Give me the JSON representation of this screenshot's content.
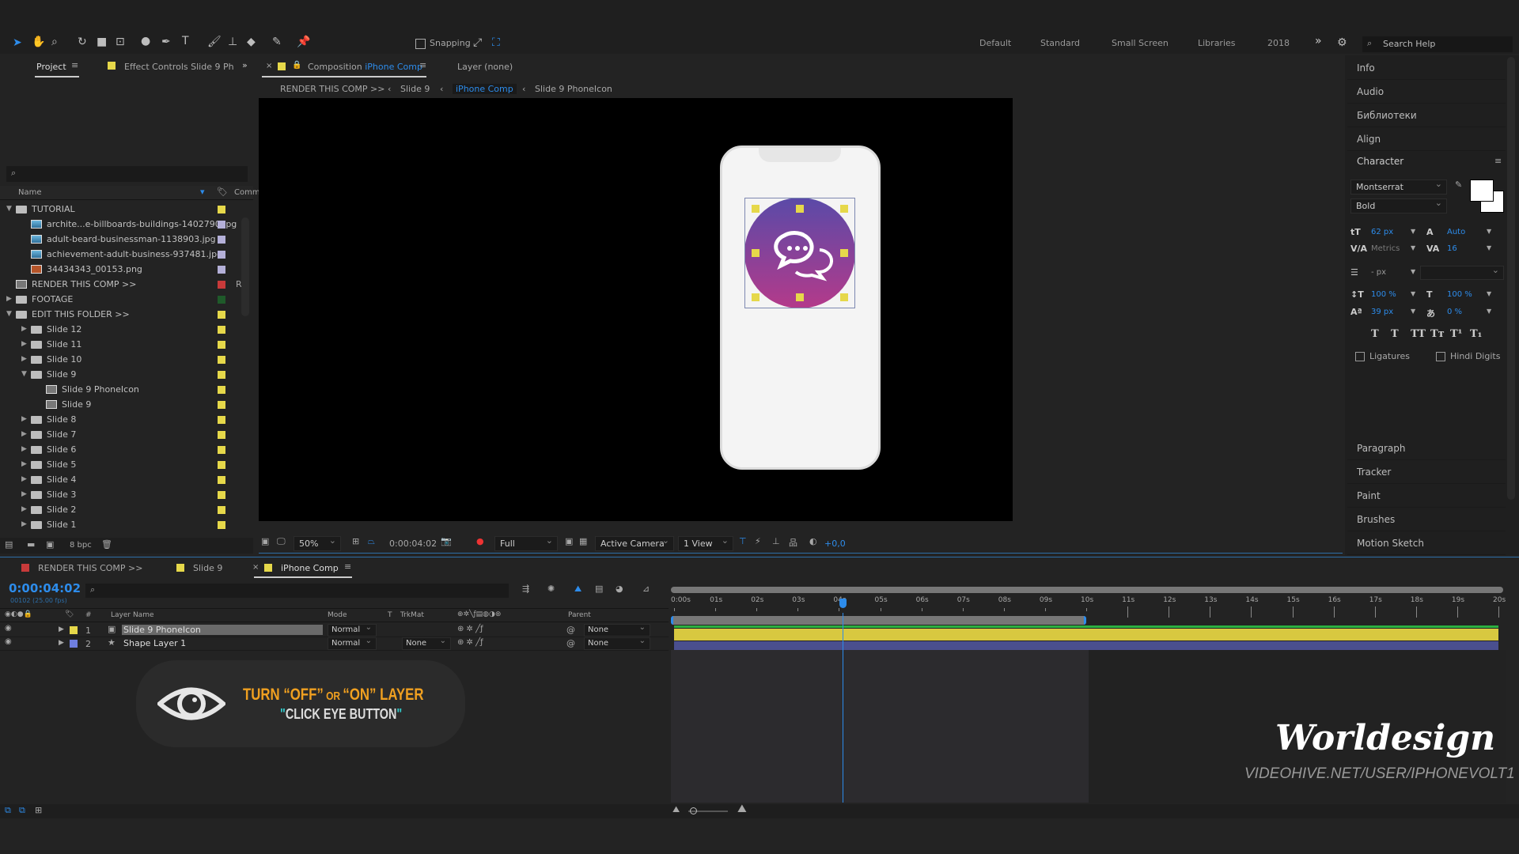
{
  "toolbar": {
    "snapping_label": "Snapping",
    "workspaces": [
      "Default",
      "Standard",
      "Small Screen",
      "Libraries",
      "2018"
    ],
    "more": "»",
    "search_placeholder": "Search Help"
  },
  "project": {
    "tab_label": "Project",
    "effect_tab_label": "Effect Controls Slide 9 Ph",
    "more": "»",
    "search_placeholder": "",
    "col_name": "Name",
    "col_comment": "Comm",
    "items": [
      {
        "label": "TUTORIAL",
        "type": "folder",
        "depth": 0,
        "expanded": true,
        "color": "#e6d84a"
      },
      {
        "label": "archite...e-billboards-buildings-1402790.jpg",
        "type": "image",
        "depth": 1,
        "color": "#b4b0d8"
      },
      {
        "label": "adult-beard-businessman-1138903.jpg",
        "type": "image",
        "depth": 1,
        "color": "#b4b0d8"
      },
      {
        "label": "achievement-adult-business-937481.jpg",
        "type": "image",
        "depth": 1,
        "color": "#b4b0d8"
      },
      {
        "label": "34434343_00153.png",
        "type": "png",
        "depth": 1,
        "color": "#b4b0d8"
      },
      {
        "label": "RENDER THIS COMP >>",
        "type": "comp",
        "depth": 0,
        "color": "#c83a3a",
        "comment": "R"
      },
      {
        "label": "FOOTAGE",
        "type": "folder",
        "depth": 0,
        "expanded": false,
        "color": "#1f5a2a"
      },
      {
        "label": "EDIT THIS FOLDER >>",
        "type": "folder",
        "depth": 0,
        "expanded": true,
        "color": "#e6d84a"
      },
      {
        "label": "Slide 12",
        "type": "folder",
        "depth": 1,
        "expanded": false,
        "color": "#e6d84a"
      },
      {
        "label": "Slide 11",
        "type": "folder",
        "depth": 1,
        "expanded": false,
        "color": "#e6d84a"
      },
      {
        "label": "Slide 10",
        "type": "folder",
        "depth": 1,
        "expanded": false,
        "color": "#e6d84a"
      },
      {
        "label": "Slide 9",
        "type": "folder",
        "depth": 1,
        "expanded": true,
        "color": "#e6d84a"
      },
      {
        "label": "Slide 9 PhoneIcon",
        "type": "comp",
        "depth": 2,
        "color": "#e6d84a"
      },
      {
        "label": "Slide 9",
        "type": "comp",
        "depth": 2,
        "color": "#e6d84a"
      },
      {
        "label": "Slide 8",
        "type": "folder",
        "depth": 1,
        "expanded": false,
        "color": "#e6d84a"
      },
      {
        "label": "Slide 7",
        "type": "folder",
        "depth": 1,
        "expanded": false,
        "color": "#e6d84a"
      },
      {
        "label": "Slide 6",
        "type": "folder",
        "depth": 1,
        "expanded": false,
        "color": "#e6d84a"
      },
      {
        "label": "Slide 5",
        "type": "folder",
        "depth": 1,
        "expanded": false,
        "color": "#e6d84a"
      },
      {
        "label": "Slide 4",
        "type": "folder",
        "depth": 1,
        "expanded": false,
        "color": "#e6d84a"
      },
      {
        "label": "Slide 3",
        "type": "folder",
        "depth": 1,
        "expanded": false,
        "color": "#e6d84a"
      },
      {
        "label": "Slide 2",
        "type": "folder",
        "depth": 1,
        "expanded": false,
        "color": "#e6d84a"
      },
      {
        "label": "Slide 1",
        "type": "folder",
        "depth": 1,
        "expanded": false,
        "color": "#e6d84a"
      }
    ],
    "bpc": "8 bpc"
  },
  "composition": {
    "tab_prefix": "Composition",
    "tab_name": "iPhone Comp",
    "layer_tab": "Layer (none)",
    "breadcrumbs": [
      "RENDER THIS COMP >>",
      "Slide 9",
      "iPhone Comp",
      "Slide 9 PhoneIcon"
    ],
    "zoom": "50%",
    "timecode": "0:00:04:02",
    "resolution": "Full",
    "camera": "Active Camera",
    "views": "1 View",
    "exposure": "+0,0"
  },
  "right_panel": {
    "items_top": [
      "Info",
      "Audio",
      "Библиотеки",
      "Align"
    ],
    "character": {
      "title": "Character",
      "font": "Montserrat",
      "style": "Bold",
      "size": "62 px",
      "leading": "Auto",
      "kerning": "Metrics",
      "tracking": "16",
      "stroke": "- px",
      "vscale": "100 %",
      "hscale": "100 %",
      "baseline": "39 px",
      "tsume": "0 %",
      "ligatures": "Ligatures",
      "hindi": "Hindi Digits",
      "styles": [
        "T",
        "T",
        "TT",
        "Tт",
        "T¹",
        "T₁"
      ]
    },
    "items_bottom": [
      "Paragraph",
      "Tracker",
      "Paint",
      "Brushes",
      "Motion Sketch"
    ]
  },
  "timeline": {
    "tabs": [
      {
        "label": "RENDER THIS COMP >>",
        "color": "#c83a3a"
      },
      {
        "label": "Slide 9",
        "color": "#e6d84a"
      },
      {
        "label": "iPhone Comp",
        "color": "#e6d84a"
      }
    ],
    "timecode": "0:00:04:02",
    "frame_info": "00102 (25.00 fps)",
    "headers": {
      "num": "#",
      "layer_name": "Layer Name",
      "mode": "Mode",
      "t": "T",
      "trkmat": "TrkMat",
      "parent": "Parent"
    },
    "layers": [
      {
        "num": "1",
        "name": "Slide 9 PhoneIcon",
        "mode": "Normal",
        "trkmat": "",
        "parent": "None",
        "color": "#e6d84a",
        "selected": true
      },
      {
        "num": "2",
        "name": "Shape Layer 1",
        "mode": "Normal",
        "trkmat": "None",
        "parent": "None",
        "color": "#6f7fe0",
        "selected": false
      }
    ],
    "ruler": [
      "0:00s",
      "01s",
      "02s",
      "03s",
      "04s",
      "05s",
      "06s",
      "07s",
      "08s",
      "09s",
      "10s",
      "11s",
      "12s",
      "13s",
      "14s",
      "15s",
      "16s",
      "17s",
      "18s",
      "19s",
      "20s"
    ],
    "duration_s": 20,
    "playhead_s": 4.08,
    "work_area_end_s": 10
  },
  "overlay": {
    "line1_a": "TURN ",
    "line1_b": "“OFF”",
    "line1_c": " OR ",
    "line1_d": "“ON”",
    "line1_e": " LAYER",
    "line2": "CLICK EYE BUTTON",
    "accent": "#f0a020"
  },
  "watermark": {
    "logo": "Worldesign",
    "url": "VIDEOHIVE.NET/USER/IPHONEVOLT1"
  },
  "colors": {
    "accent_blue": "#2d8ceb",
    "icon_gradient_top": "#5a4aa8",
    "icon_gradient_bottom": "#b43a8a"
  }
}
